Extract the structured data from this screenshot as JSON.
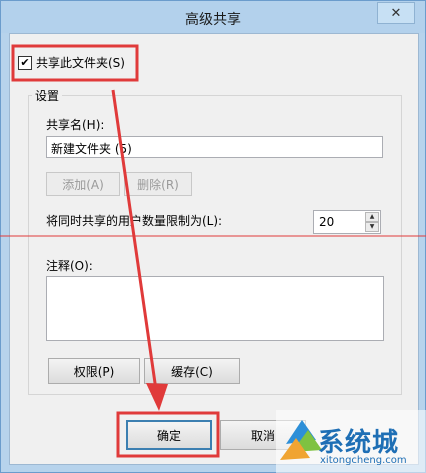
{
  "dialog": {
    "title": "高级共享",
    "close_glyph": "✕"
  },
  "share_checkbox": {
    "label": "共享此文件夹(S)",
    "check_glyph": "✔",
    "checked": true
  },
  "settings": {
    "group_label": "设置",
    "share_name_label": "共享名(H):",
    "share_name_value": "新建文件夹 (5)",
    "add_label": "添加(A)",
    "remove_label": "删除(R)",
    "user_limit_label": "将同时共享的用户数量限制为(L):",
    "user_limit_value": "20",
    "comments_label": "注释(O):",
    "comments_value": "",
    "permissions_label": "权限(P)",
    "caching_label": "缓存(C)"
  },
  "footer": {
    "ok_label": "确定",
    "cancel_label": "取消"
  },
  "watermark": {
    "brand": "系统城",
    "url": "xitongcheng.com"
  },
  "colors": {
    "annotation_red": "#e03a3a",
    "accent_blue": "#3c7fb1"
  },
  "icons": {
    "spin_up": "▲",
    "spin_down": "▼"
  }
}
